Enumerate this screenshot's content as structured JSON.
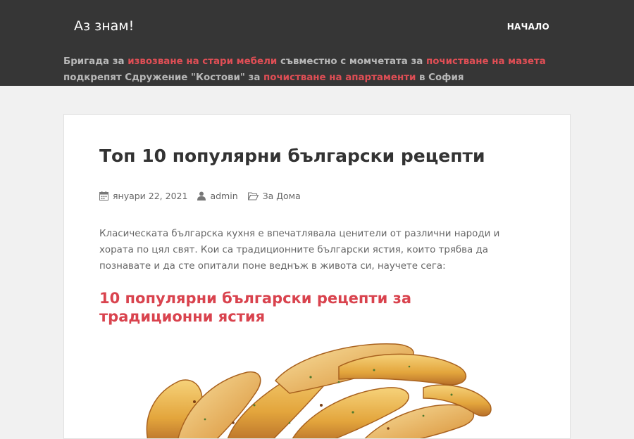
{
  "header": {
    "site_title": "Аз знам!",
    "nav_home": "НАЧАЛО",
    "banner": {
      "t1": "Бригада за ",
      "l1": "извозване на стари мебели",
      "t2": " съвместно с момчетата за ",
      "l2": "почистване на мазета",
      "t3": " подкрепят Сдружение \"Костови\" за ",
      "l3": "почистване на апартаменти",
      "t4": " в София"
    }
  },
  "post": {
    "title": "Топ 10 популярни български рецепти",
    "date": "януари 22, 2021",
    "author": "admin",
    "category": "За Дома",
    "intro": "Класическата българска кухня е впечатлявала ценители от различни народи и хората по цял свят. Кои са традиционните български ястия, които трябва да познавате и да сте опитали поне веднъж в живота си, научете сега:",
    "subheading": "10 популярни български рецепти за традиционни ястия"
  },
  "icons": {
    "calendar": "calendar-icon",
    "user": "user-icon",
    "folder": "folder-icon"
  },
  "colors": {
    "header_bg": "#363636",
    "accent": "#e04e55",
    "heading_red": "#d9434e"
  }
}
